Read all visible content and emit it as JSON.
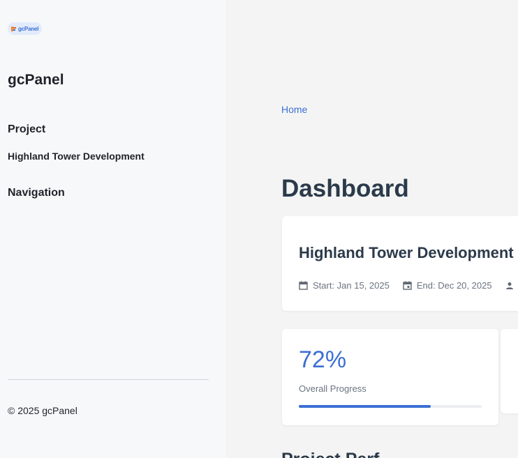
{
  "logo": {
    "text": "gcPanel"
  },
  "sidebar": {
    "brand": "gcPanel",
    "project_heading": "Project",
    "project_name": "Highland Tower Development",
    "navigation_heading": "Navigation",
    "footer": "© 2025 gcPanel"
  },
  "main": {
    "breadcrumb": "Home",
    "page_title": "Dashboard",
    "project_card": {
      "title": "Highland Tower Development",
      "start": "Start: Jan 15, 2025",
      "end": "End: Dec 20, 2025"
    },
    "progress_card": {
      "value": "72%",
      "label": "Overall Progress",
      "progress_fraction": 0.72
    },
    "section_title": "Project Perf"
  },
  "icons": {
    "start": "calendar-icon",
    "end": "calendar-event-icon",
    "manager": "person-icon"
  },
  "colors": {
    "accent": "#3b6fd4",
    "sidebar_bg": "#f7f8fa",
    "main_bg": "#f4f4f5",
    "heading": "#2b3a4a"
  }
}
